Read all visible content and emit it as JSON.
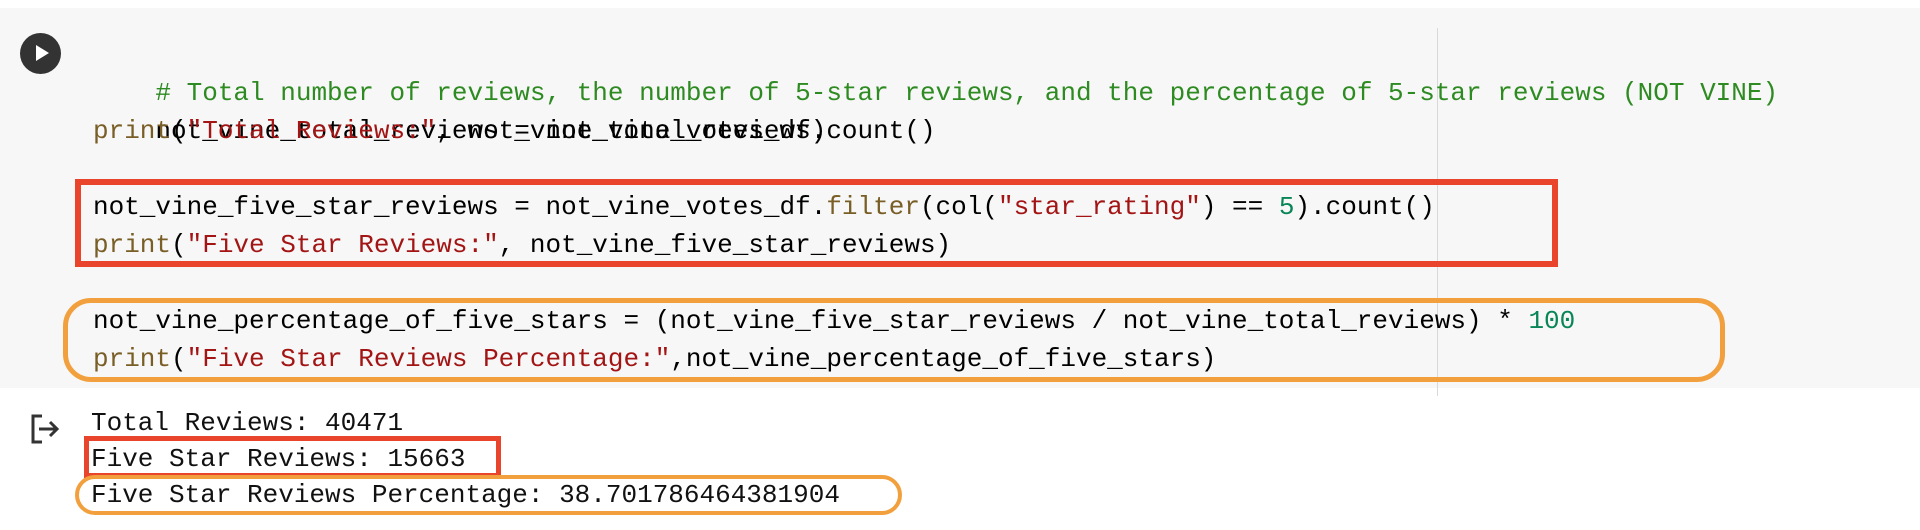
{
  "cell": {
    "run_button_icon": "play-icon",
    "code": {
      "line1_comment": "# Total number of reviews, the number of 5-star reviews, and the percentage of 5-star reviews (NOT VINE)",
      "line2_lhs": "not_vine_total_reviews = not_vine_votes_df.count()",
      "line3_print": "print",
      "line3_open": "(",
      "line3_string": "\"Total Reviews:\"",
      "line3_rest": ", not_vine_total_reviews)",
      "line4_lhs": "not_vine_five_star_reviews = not_vine_votes_df.",
      "line4_method": "filter",
      "line4_mid": "(col(",
      "line4_string": "\"star_rating\"",
      "line4_op": ") == ",
      "line4_number": "5",
      "line4_rest": ").count()",
      "line5_print": "print",
      "line5_open": "(",
      "line5_string": "\"Five Star Reviews:\"",
      "line5_rest": ", not_vine_five_star_reviews)",
      "line6_text": "not_vine_percentage_of_five_stars = (not_vine_five_star_reviews / not_vine_total_reviews) * ",
      "line6_number": "100",
      "line7_print": "print",
      "line7_open": "(",
      "line7_string": "\"Five Star Reviews Percentage:\"",
      "line7_rest": ",not_vine_percentage_of_five_stars)"
    }
  },
  "output": {
    "icon": "output-redirect-icon",
    "lines": [
      "Total Reviews: 40471",
      "Five Star Reviews: 15663",
      "Five Star Reviews Percentage: 38.701786464381904"
    ]
  },
  "colors": {
    "highlight_red": "#e8452c",
    "highlight_orange": "#f2a03d",
    "comment": "#2e8b22",
    "string": "#a31515",
    "number": "#098658",
    "builtin": "#795e26"
  }
}
